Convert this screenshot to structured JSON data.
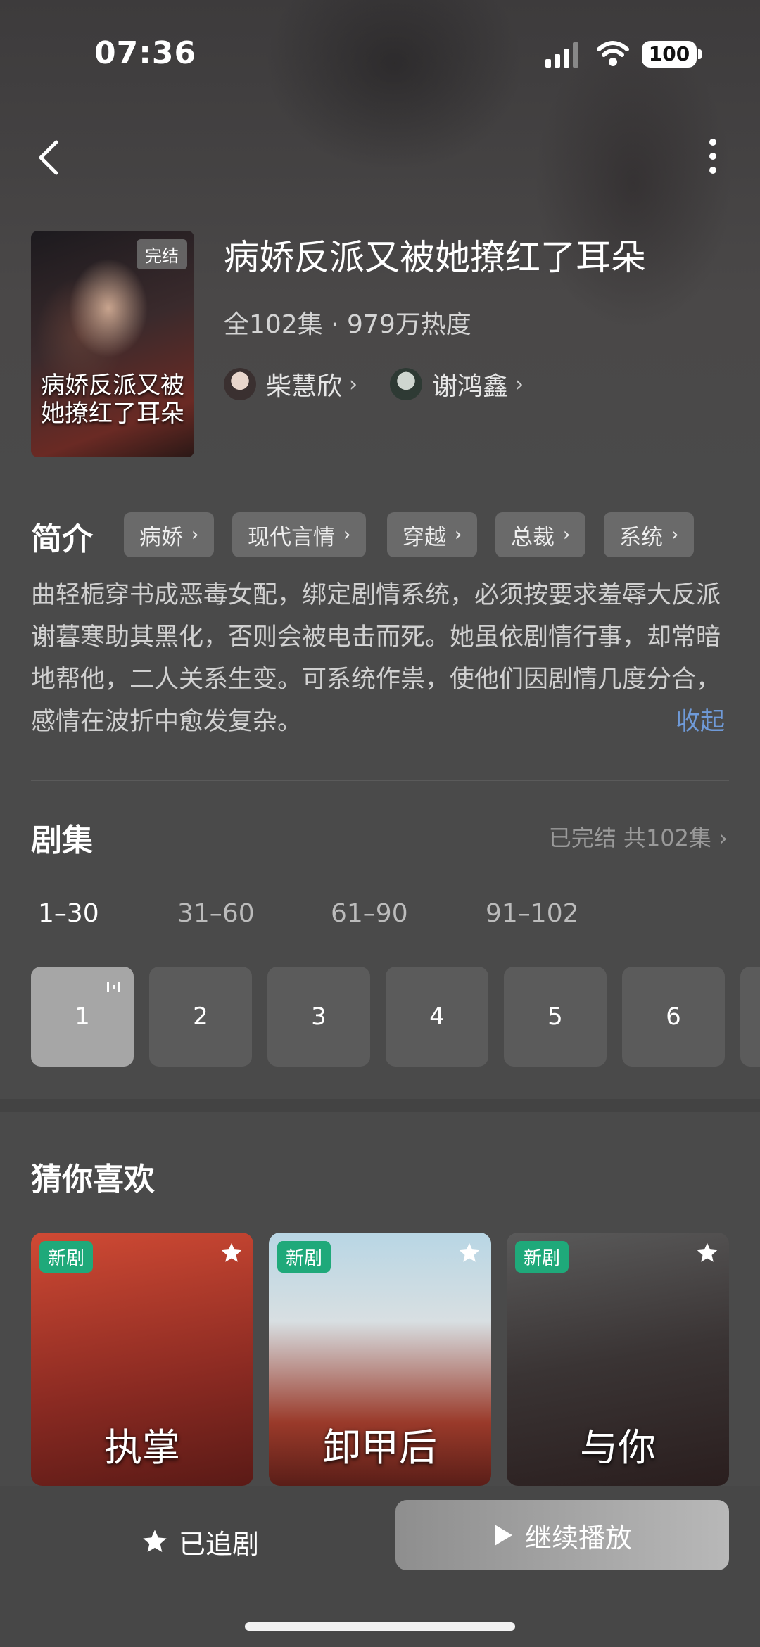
{
  "status_bar": {
    "time": "07:36",
    "battery": "100"
  },
  "drama": {
    "title": "病娇反派又被她撩红了耳朵",
    "meta": "全102集 · 979万热度",
    "poster_badge": "完结",
    "poster_title": "病娇反派又被她撩红了耳朵",
    "actors": [
      {
        "name": "柴慧欣",
        "chevron": "›"
      },
      {
        "name": "谢鸿鑫",
        "chevron": "›"
      }
    ]
  },
  "intro": {
    "label": "简介",
    "tags": [
      {
        "label": "病娇",
        "chevron": "›"
      },
      {
        "label": "现代言情",
        "chevron": "›"
      },
      {
        "label": "穿越",
        "chevron": "›"
      },
      {
        "label": "总裁",
        "chevron": "›"
      },
      {
        "label": "系统",
        "chevron": "›"
      }
    ],
    "description": "曲轻栀穿书成恶毒女配，绑定剧情系统，必须按要求羞辱大反派谢暮寒助其黑化，否则会被电击而死。她虽依剧情行事，却常暗地帮他，二人关系生变。可系统作祟，使他们因剧情几度分合，感情在波折中愈发复杂。",
    "collapse_label": "收起"
  },
  "episodes": {
    "label": "剧集",
    "status": "已完结 共102集 ›",
    "ranges": [
      "1–30",
      "31–60",
      "61–90",
      "91–102"
    ],
    "active_range": 0,
    "cells": [
      "1",
      "2",
      "3",
      "4",
      "5",
      "6"
    ],
    "active_cell": 0
  },
  "recommend": {
    "label": "猜你喜欢",
    "cards": [
      {
        "badge": "新剧",
        "art_text": "执掌",
        "colors": [
          "#c23b2a",
          "#8a1e18"
        ]
      },
      {
        "badge": "新剧",
        "art_text": "卸甲后",
        "colors": [
          "#9cc3d8",
          "#7a2a20"
        ]
      },
      {
        "badge": "新剧",
        "art_text": "与你",
        "colors": [
          "#3a3a3a",
          "#1e1e1e"
        ]
      }
    ]
  },
  "bottom": {
    "follow_label": "已追剧",
    "play_label": "继续播放"
  },
  "icons": {
    "back": "chevron-left-icon",
    "more": "more-vertical-icon",
    "star": "star-icon",
    "play": "play-icon"
  }
}
